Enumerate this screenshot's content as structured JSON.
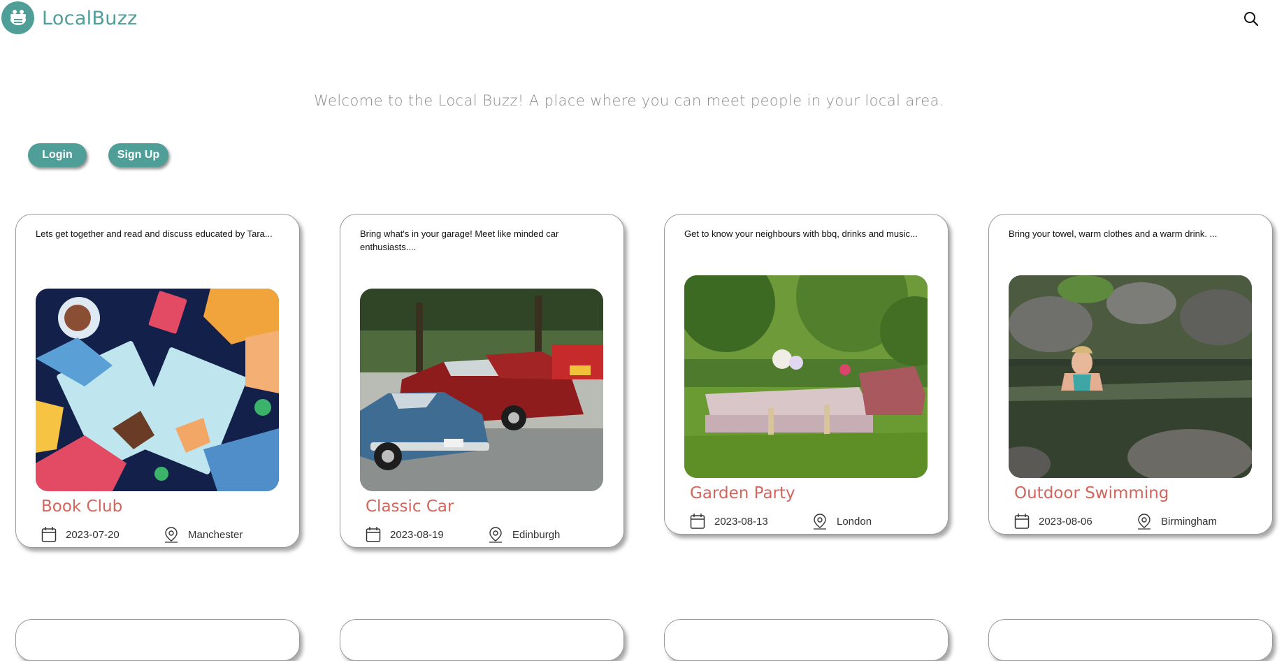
{
  "app": {
    "name": "LocalBuzz"
  },
  "header": {
    "search_icon": "search-icon"
  },
  "welcome": "Welcome to the Local Buzz! A place where you can meet people in your local area.",
  "auth": {
    "login": "Login",
    "signup": "Sign Up"
  },
  "colors": {
    "brand": "#4f9e98",
    "title": "#d3655c"
  },
  "events": [
    {
      "title": "Book Club",
      "description": "Lets get together and read and discuss educated by Tara...",
      "date": "2023-07-20",
      "location": "Manchester",
      "image": "book-club-illustration"
    },
    {
      "title": "Classic Car",
      "description": "Bring what's in your garage! Meet like minded car enthusiasts....",
      "date": "2023-08-19",
      "location": "Edinburgh",
      "image": "classic-cars-photo"
    },
    {
      "title": "Garden Party",
      "description": "Get to know your neighbours with bbq, drinks and music...",
      "date": "2023-08-13",
      "location": "London",
      "image": "garden-party-photo"
    },
    {
      "title": "Outdoor Swimming",
      "description": "Bring your towel, warm clothes and a warm drink. ...",
      "date": "2023-08-06",
      "location": "Birmingham",
      "image": "outdoor-swimming-photo"
    }
  ]
}
